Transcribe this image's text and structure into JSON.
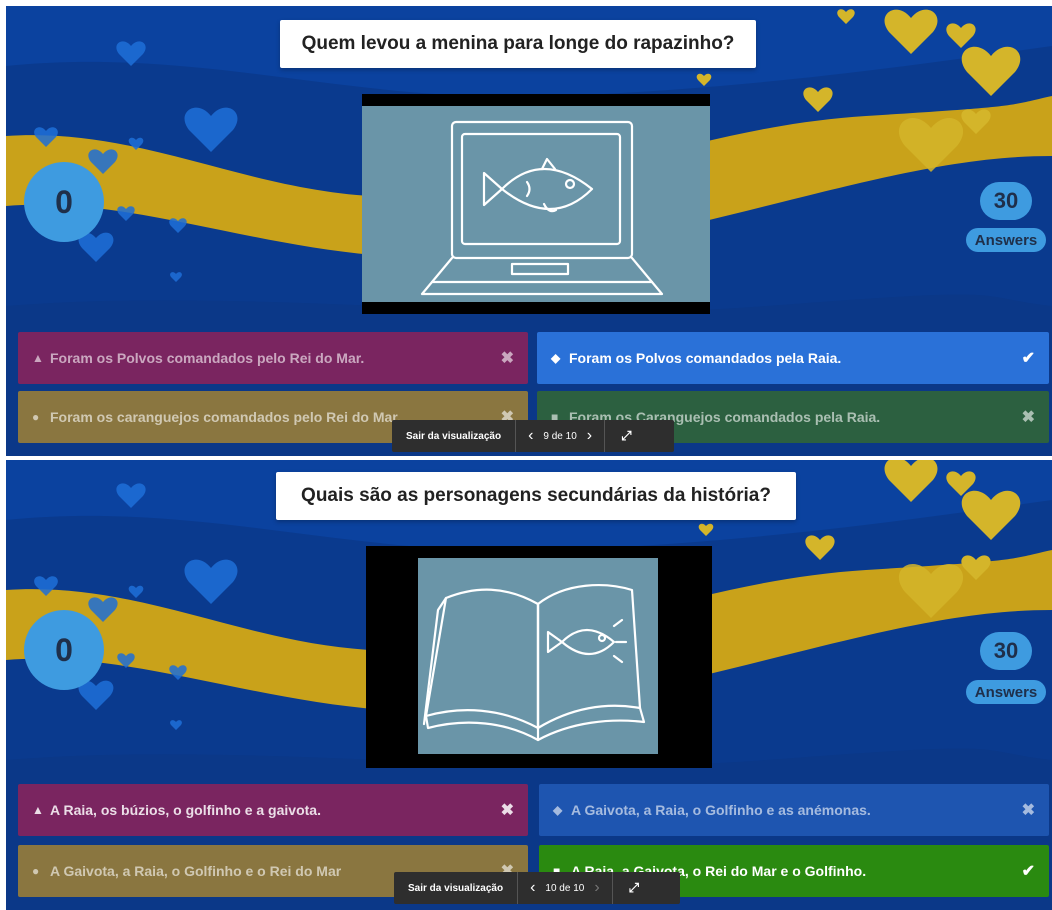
{
  "colors": {
    "background": "#0a3a8e",
    "ribbon": "#c9a21a",
    "heart_gold": "#d4b52a",
    "heart_blue": "#1e6fd8",
    "triangle_answer": "#7a2560",
    "diamond_answer": "#2a71d8",
    "circle_answer": "#8a7640",
    "square_answer_muted": "#2c6040",
    "square_answer_correct": "#2a8a10",
    "badge": "#3e9be0"
  },
  "slides": [
    {
      "question": "Quem levou a menina para longe do rapazinho?",
      "media_icon": "laptop-fish-sketch",
      "score": "0",
      "answer_count": "30",
      "answers_label": "Answers",
      "answers": [
        {
          "shape": "▲",
          "shape_name": "triangle-icon",
          "text": "Foram os Polvos comandados pelo Rei do Mar.",
          "mark": "✖",
          "correct": false
        },
        {
          "shape": "◆",
          "shape_name": "diamond-icon",
          "text": "Foram os Polvos comandados pela Raia.",
          "mark": "✔",
          "correct": true
        },
        {
          "shape": "●",
          "shape_name": "circle-icon",
          "text": "Foram os caranguejos comandados pelo Rei do Mar.",
          "mark": "✖",
          "correct": false
        },
        {
          "shape": "■",
          "shape_name": "square-icon",
          "text": "Foram os Caranguejos comandados pela Raia.",
          "mark": "✖",
          "correct": false
        }
      ],
      "toolbar": {
        "exit_label": "Sair da visualização",
        "pager": "9 de 10",
        "prev": "‹",
        "next": "›",
        "expand": "⤢"
      }
    },
    {
      "question": "Quais são as personagens secundárias da história?",
      "media_icon": "book-fish-sketch",
      "score": "0",
      "answer_count": "30",
      "answers_label": "Answers",
      "answers": [
        {
          "shape": "▲",
          "shape_name": "triangle-icon",
          "text": "A Raia, os búzios, o golfinho e a gaivota.",
          "mark": "✖",
          "correct": false
        },
        {
          "shape": "◆",
          "shape_name": "diamond-icon",
          "text": "A Gaivota, a Raia, o Golfinho e as anémonas.",
          "mark": "✖",
          "correct": false
        },
        {
          "shape": "●",
          "shape_name": "circle-icon",
          "text": "A Gaivota, a Raia, o Golfinho e o Rei do Mar",
          "mark": "✖",
          "correct": false
        },
        {
          "shape": "■",
          "shape_name": "square-icon",
          "text": "A Raia, a Gaivota, o Rei do Mar e o Golfinho.",
          "mark": "✔",
          "correct": true
        }
      ],
      "toolbar": {
        "exit_label": "Sair da visualização",
        "pager": "10 de 10",
        "prev": "‹",
        "next": "›",
        "expand": "⤢"
      }
    }
  ]
}
